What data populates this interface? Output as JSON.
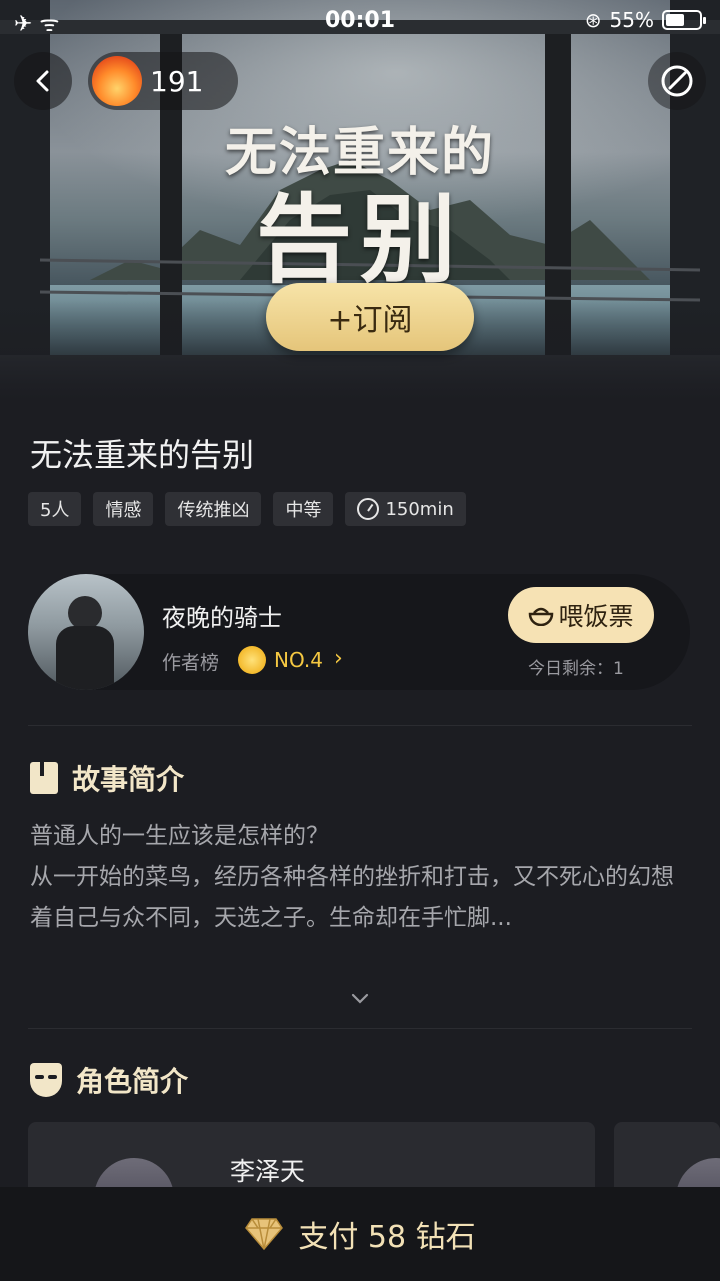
{
  "status_bar": {
    "left": "✈ ᯤ",
    "time": "00:01",
    "battery": "55%"
  },
  "nav": {
    "heat_count": "191"
  },
  "cover": {
    "title_line1": "无法重来的",
    "title_line2": "告别",
    "subscribe_label": "+订阅"
  },
  "story": {
    "title": "无法重来的告别",
    "tags": [
      "5人",
      "情感",
      "传统推凶",
      "中等"
    ],
    "duration": "150min"
  },
  "author": {
    "name": "夜晚的骑士",
    "rank_label": "作者榜",
    "rank_value": "NO.4",
    "feed_label": "喂饭票",
    "remain_today": "今日剩余：1"
  },
  "synopsis": {
    "heading": "故事简介",
    "text": "普通人的一生应该是怎样的？\n从一开始的菜鸟，经历各种各样的挫折和打击，又不死心的幻想着自己与众不同，天选之子。生命却在手忙脚..."
  },
  "characters": {
    "heading": "角色简介",
    "items": [
      {
        "name": "李泽天"
      }
    ]
  },
  "pay": {
    "label": "支付 58 钻石"
  },
  "colors": {
    "accent_gold": "#f2e6c8",
    "rank_gold": "#f5c842",
    "background": "#1c1d22"
  }
}
